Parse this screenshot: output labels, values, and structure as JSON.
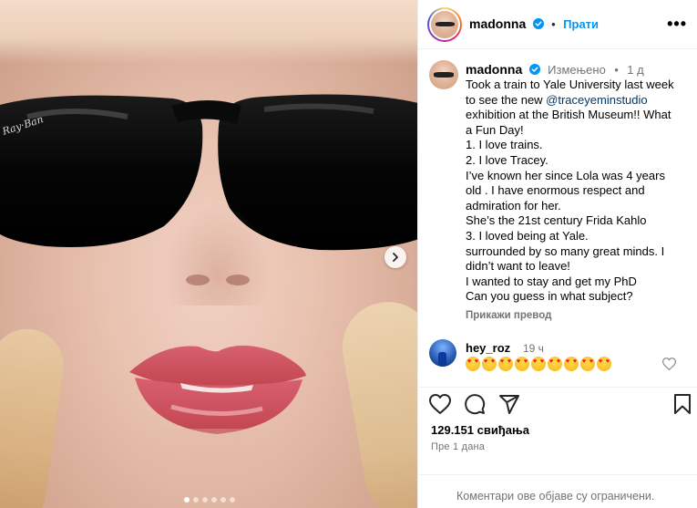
{
  "post": {
    "username": "madonna",
    "follow_label": "Прати",
    "more_label": "•••",
    "caption_username": "madonna",
    "edited_label": "Измењено",
    "separator": "•",
    "time_ago": "1 д",
    "caption_lines": [
      {
        "text": "Took a train to Yale University last week"
      },
      {
        "pre": "to see the new ",
        "mention": "@traceyeminstudio"
      },
      {
        "text": "exhibition at the British Museum!! What"
      },
      {
        "text": "a Fun Day!"
      },
      {
        "text": "1. I love trains."
      },
      {
        "text": "2. I love Tracey."
      },
      {
        "text": "I’ve known her since Lola was 4 years"
      },
      {
        "text": "old . I have enormous respect and"
      },
      {
        "text": "admiration for her."
      },
      {
        "text": "She’s the 21st century Frida Kahlo"
      },
      {
        "text": "3. I loved being at Yale."
      },
      {
        "text": "surrounded by so many great minds. I"
      },
      {
        "text": "didn’t want to leave!"
      },
      {
        "text": "I wanted to stay and get my PhD"
      },
      {
        "text": "Can you guess in what subject?"
      }
    ],
    "translate_label": "Прикажи превод",
    "likes": "129.151 свиђања",
    "date": "Пре 1 дана",
    "comments_restricted": "Коментари ове објаве су ограничени."
  },
  "comment": {
    "username": "hey_roz",
    "time": "19 ч",
    "emoji_count": 9
  },
  "carousel": {
    "slide_count": 6,
    "active_index": 0
  },
  "icons": {
    "verified": "verified-badge-icon",
    "like": "heart-icon",
    "comment": "comment-icon",
    "share": "share-icon",
    "save": "bookmark-icon",
    "next": "chevron-right-icon"
  },
  "colors": {
    "link": "#0095f6",
    "mention": "#00376b",
    "muted": "#737373"
  }
}
